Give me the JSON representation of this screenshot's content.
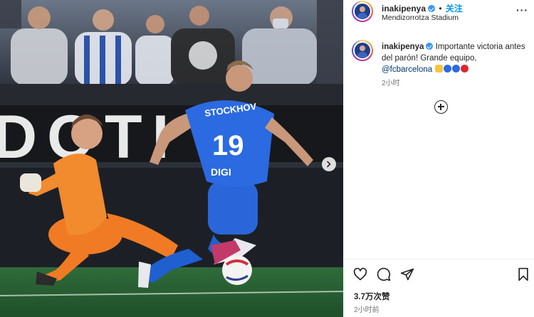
{
  "post": {
    "username": "inakipenya",
    "follow_label": "关注",
    "separator": "•",
    "location": "Mendizorrotza Stadium",
    "more_label": "···"
  },
  "caption": {
    "username": "inakipenya",
    "text": "Importante victoria antes del parón! Grande equipo,",
    "mention": "@fcbarcelona",
    "emojis": [
      "flexed-biceps",
      "blue-circle",
      "blue-circle",
      "red-circle"
    ],
    "time": "2小时"
  },
  "photo": {
    "jersey_name": "STOCKHOV",
    "jersey_number": "19",
    "sponsor": "DIGI",
    "banner_text": "DOTI"
  },
  "footer": {
    "likes": "3.7万次赞",
    "time": "2小时前"
  },
  "colors": {
    "accent": "#0095f6",
    "verified": "#3797f0",
    "mention": "#00376b"
  }
}
